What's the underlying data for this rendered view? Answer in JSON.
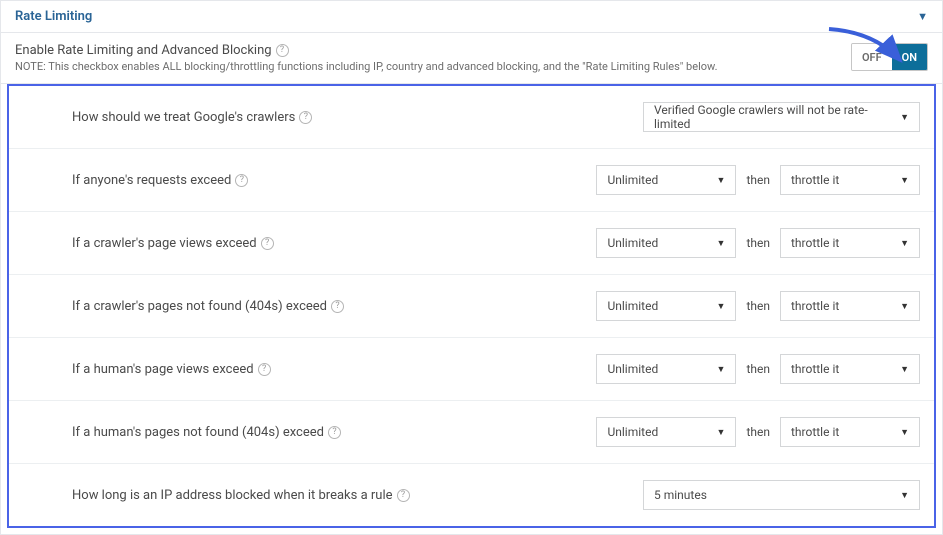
{
  "header": {
    "title": "Rate Limiting"
  },
  "enable": {
    "label": "Enable Rate Limiting and Advanced Blocking",
    "note": "NOTE: This checkbox enables ALL blocking/throttling functions including IP, country and advanced blocking, and the \"Rate Limiting Rules\" below.",
    "off": "OFF",
    "on": "ON"
  },
  "then_label": "then",
  "rows": {
    "google": {
      "label": "How should we treat Google's crawlers",
      "value": "Verified Google crawlers will not be rate-limited"
    },
    "anyone": {
      "label": "If anyone's requests exceed",
      "value": "Unlimited",
      "action": "throttle it"
    },
    "crawler_views": {
      "label": "If a crawler's page views exceed",
      "value": "Unlimited",
      "action": "throttle it"
    },
    "crawler_404": {
      "label": "If a crawler's pages not found (404s) exceed",
      "value": "Unlimited",
      "action": "throttle it"
    },
    "human_views": {
      "label": "If a human's page views exceed",
      "value": "Unlimited",
      "action": "throttle it"
    },
    "human_404": {
      "label": "If a human's pages not found (404s) exceed",
      "value": "Unlimited",
      "action": "throttle it"
    },
    "block_duration": {
      "label": "How long is an IP address blocked when it breaks a rule",
      "value": "5 minutes"
    }
  }
}
